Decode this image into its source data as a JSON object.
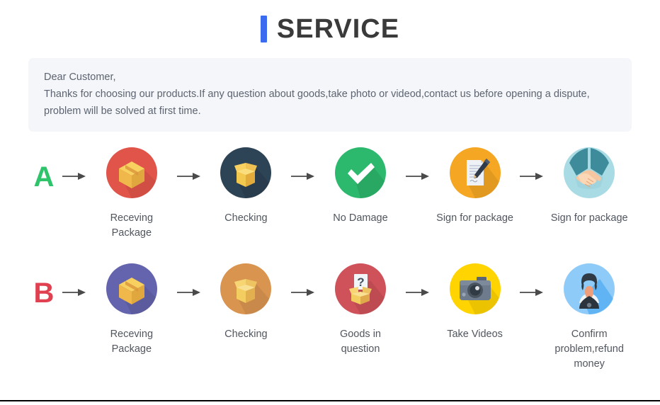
{
  "header": {
    "title": "SERVICE",
    "accent_color": "#3b6cf0"
  },
  "notice": {
    "greeting": "Dear Customer,",
    "line1": "Thanks for choosing our products.If any question about goods,take photo or videod,contact us before opening a dispute,",
    "line2": "problem will be solved at first time.",
    "background_color": "#f4f6fa",
    "text_color": "#5d6470"
  },
  "flows": [
    {
      "letter": "A",
      "letter_color": "#2fc36b",
      "steps": [
        {
          "label": "Receving Package",
          "icon": "closed-box-icon",
          "circle_color": "#e0544a"
        },
        {
          "label": "Checking",
          "icon": "open-box-icon",
          "circle_color": "#2d4356"
        },
        {
          "label": "No Damage",
          "icon": "check-mark-icon",
          "circle_color": "#2db96d"
        },
        {
          "label": "Sign for package",
          "icon": "signed-document-icon",
          "circle_color": "#f5a623"
        },
        {
          "label": "Sign for package",
          "icon": "handshake-icon",
          "circle_color": "#a9dbe4"
        }
      ]
    },
    {
      "letter": "B",
      "letter_color": "#e0404f",
      "steps": [
        {
          "label": "Receving Package",
          "icon": "closed-box-icon",
          "circle_color": "#6464ae"
        },
        {
          "label": "Checking",
          "icon": "open-box-icon",
          "circle_color": "#d99450"
        },
        {
          "label": "Goods in question",
          "icon": "question-box-icon",
          "circle_color": "#cf515a"
        },
        {
          "label": "Take Videos",
          "icon": "camera-icon",
          "circle_color": "#ffd400"
        },
        {
          "label": "Confirm problem,refund money",
          "icon": "support-agent-icon",
          "circle_color": "#8ecbf8"
        }
      ]
    }
  ],
  "arrow": {
    "icon": "right-arrow-icon",
    "color": "#4a4a4a"
  }
}
